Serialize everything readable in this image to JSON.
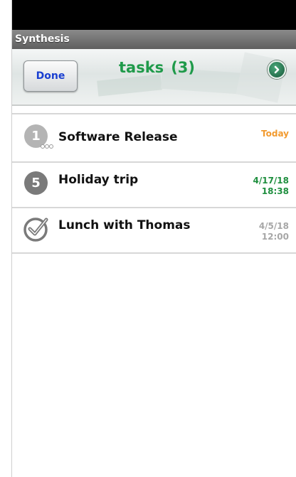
{
  "app": {
    "title": "Synthesis"
  },
  "toolbar": {
    "done_label": "Done",
    "title": "tasks",
    "count": "(3)",
    "next_icon": "chevron-right-circle-icon"
  },
  "tasks": [
    {
      "title": "Software Release",
      "badge": "1",
      "badge_icon": "number-badge-icon",
      "date_line1": "Today",
      "date_line2": "",
      "date_color": "#f29a2e"
    },
    {
      "title": "Holiday trip",
      "badge": "5",
      "badge_icon": "number-badge-icon",
      "date_line1": "4/17/18",
      "date_line2": "18:38",
      "date_color": "#1f8f3f"
    },
    {
      "title": "Lunch with Thomas",
      "badge": "",
      "badge_icon": "checkmark-circle-icon",
      "date_line1": "4/5/18",
      "date_line2": "12:00",
      "date_color": "#a7a7a7"
    }
  ],
  "colors": {
    "accent_green": "#1f9a4a",
    "done_blue": "#1a3fd1",
    "today_orange": "#f29a2e",
    "date_grey": "#a7a7a7"
  }
}
